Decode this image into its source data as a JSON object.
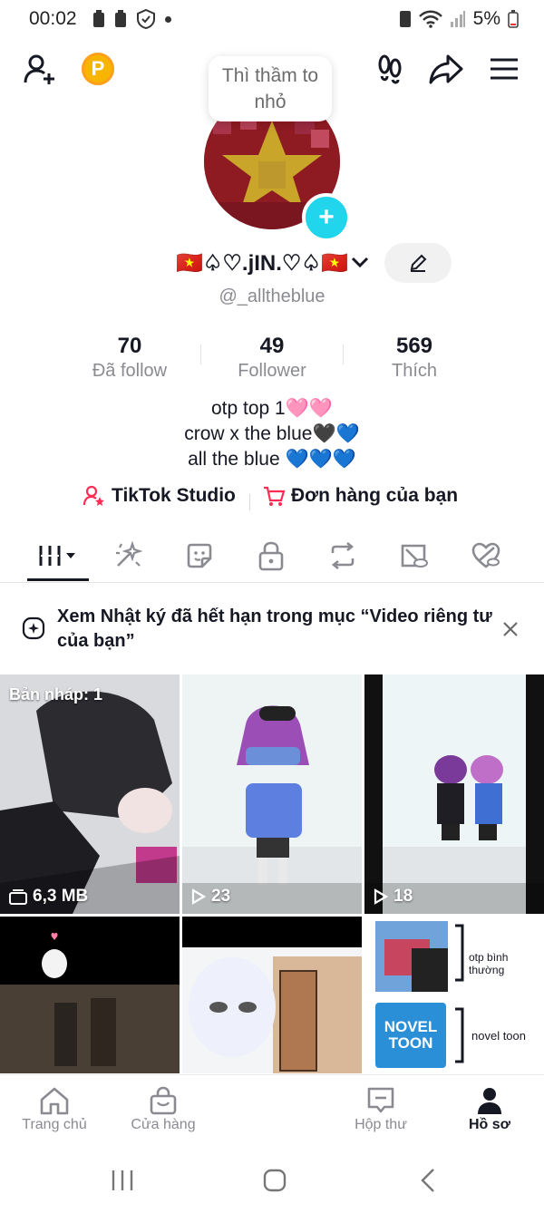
{
  "status_bar": {
    "time": "00:02",
    "battery": "5%"
  },
  "tooltip": {
    "text": "Thì thầm to nhỏ"
  },
  "profile": {
    "display_name": "🇻🇳♤♡.jIN.♡♤🇻🇳",
    "username": "@_alltheblue",
    "stats": [
      {
        "value": "70",
        "label": "Đã follow"
      },
      {
        "value": "49",
        "label": "Follower"
      },
      {
        "value": "569",
        "label": "Thích"
      }
    ],
    "bio": [
      "otp top 1🩷🩷",
      "crow x the blue🖤💙",
      "all the blue 💙💙💙"
    ],
    "links": {
      "studio": "TikTok Studio",
      "orders": "Đơn hàng của bạn"
    }
  },
  "tabs": [
    {
      "icon": "grid-icon",
      "active": true
    },
    {
      "icon": "sparkle-repost-icon"
    },
    {
      "icon": "sticker-icon"
    },
    {
      "icon": "lock-icon"
    },
    {
      "icon": "repost-icon"
    },
    {
      "icon": "hidden-tag-icon"
    },
    {
      "icon": "heart-hidden-icon"
    }
  ],
  "notice": {
    "text": "Xem Nhật ký đã hết hạn trong mục “Video riêng tư của bạn”"
  },
  "videos": [
    {
      "overlay": "Bản nháp: 1",
      "caption": "6,3 MB",
      "type": "draft"
    },
    {
      "caption": "23",
      "type": "views"
    },
    {
      "caption": "18",
      "type": "views"
    },
    {
      "type": "none"
    },
    {
      "type": "none"
    },
    {
      "type": "none",
      "text1": "otp bình thường",
      "text2": "novel toon",
      "logo": "NOVEL TOON"
    }
  ],
  "bottom_nav": [
    {
      "label": "Trang chủ",
      "icon": "home-icon"
    },
    {
      "label": "Cửa hàng",
      "icon": "shop-icon"
    },
    {
      "label": "",
      "icon": "create-icon"
    },
    {
      "label": "Hộp thư",
      "icon": "inbox-icon"
    },
    {
      "label": "Hồ sơ",
      "icon": "profile-icon",
      "active": true
    }
  ],
  "colors": {
    "accent_cyan": "#20d5ec",
    "accent_red": "#fe2c55",
    "coin": "#f7b500",
    "text_primary": "#161823",
    "text_secondary": "#8a8b91"
  }
}
